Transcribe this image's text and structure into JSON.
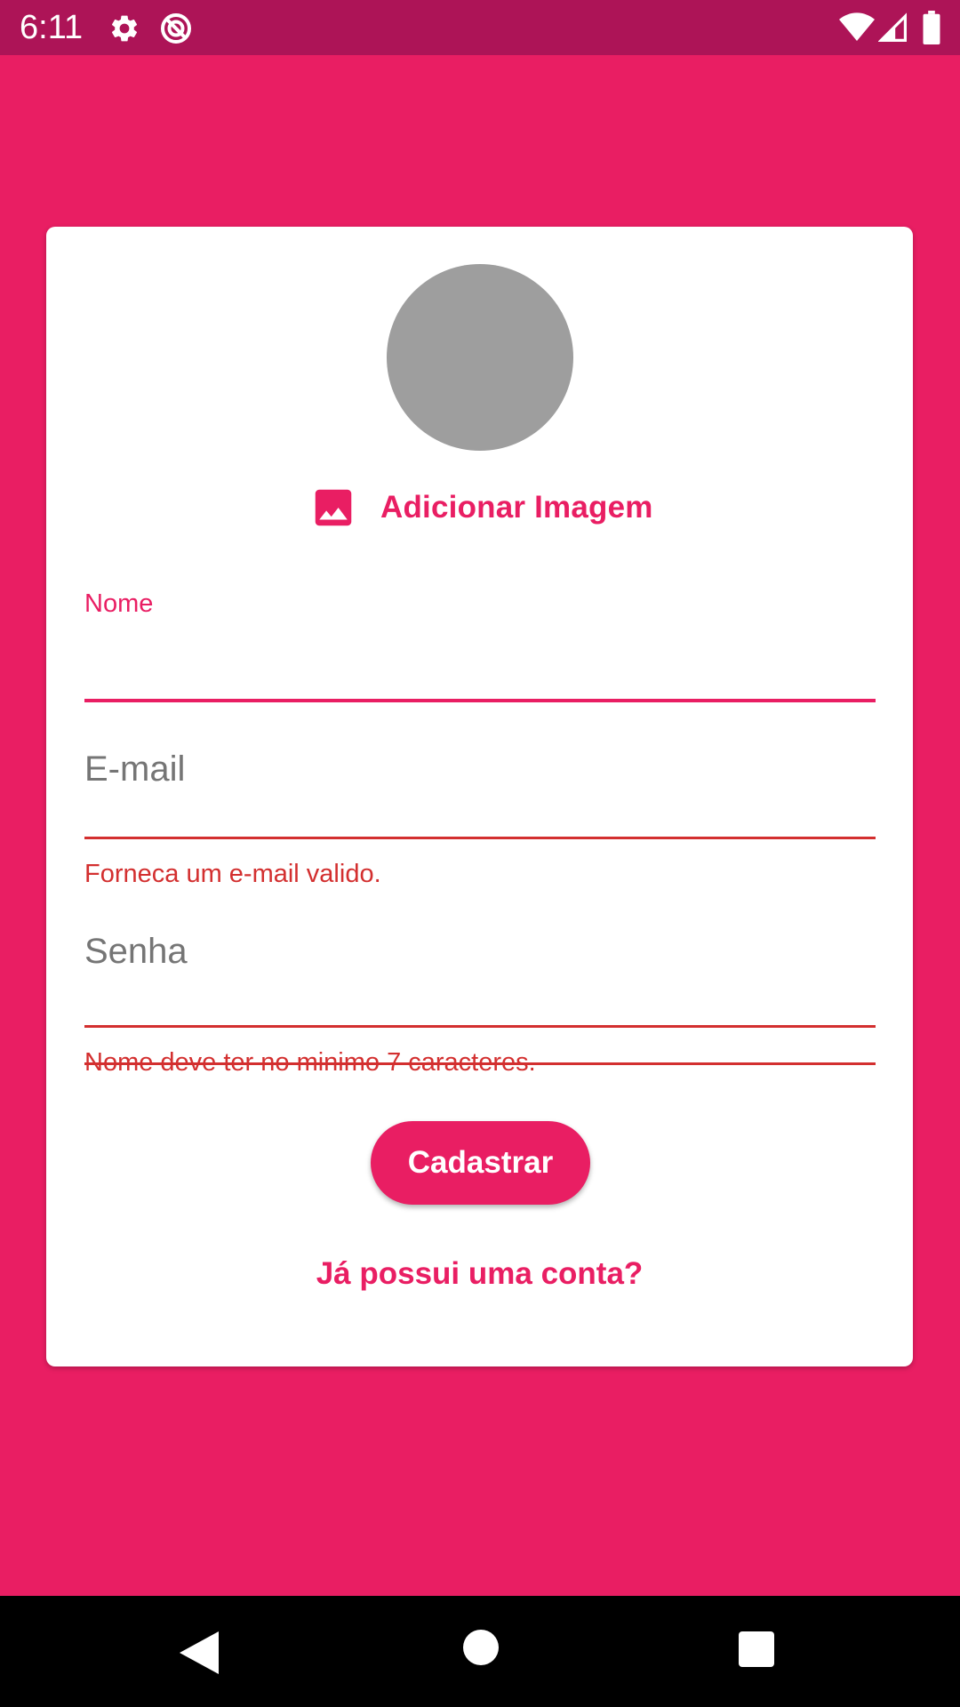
{
  "status_bar": {
    "time": "6:11",
    "icons": [
      "gear-icon",
      "vpn-icon",
      "wifi-icon",
      "signal-icon",
      "battery-icon"
    ],
    "background": "#AD1457"
  },
  "theme": {
    "accent": "#E91E63",
    "error": "#D32F2F",
    "avatar_placeholder": "#9E9E9E"
  },
  "form": {
    "add_image_label": "Adicionar Imagem",
    "add_image_icon": "image-icon",
    "name_field": {
      "label": "Nome",
      "value": ""
    },
    "email_field": {
      "placeholder": "E-mail",
      "value": "",
      "error": "Forneca um e-mail valido."
    },
    "password_field": {
      "placeholder": "Senha",
      "value": "",
      "error": "Nome deve ter no minimo 7 caracteres."
    },
    "submit_label": "Cadastrar",
    "login_link": "Já possui uma conta?"
  },
  "nav_bar": {
    "icons": [
      "back-icon",
      "home-icon",
      "recents-icon"
    ]
  }
}
